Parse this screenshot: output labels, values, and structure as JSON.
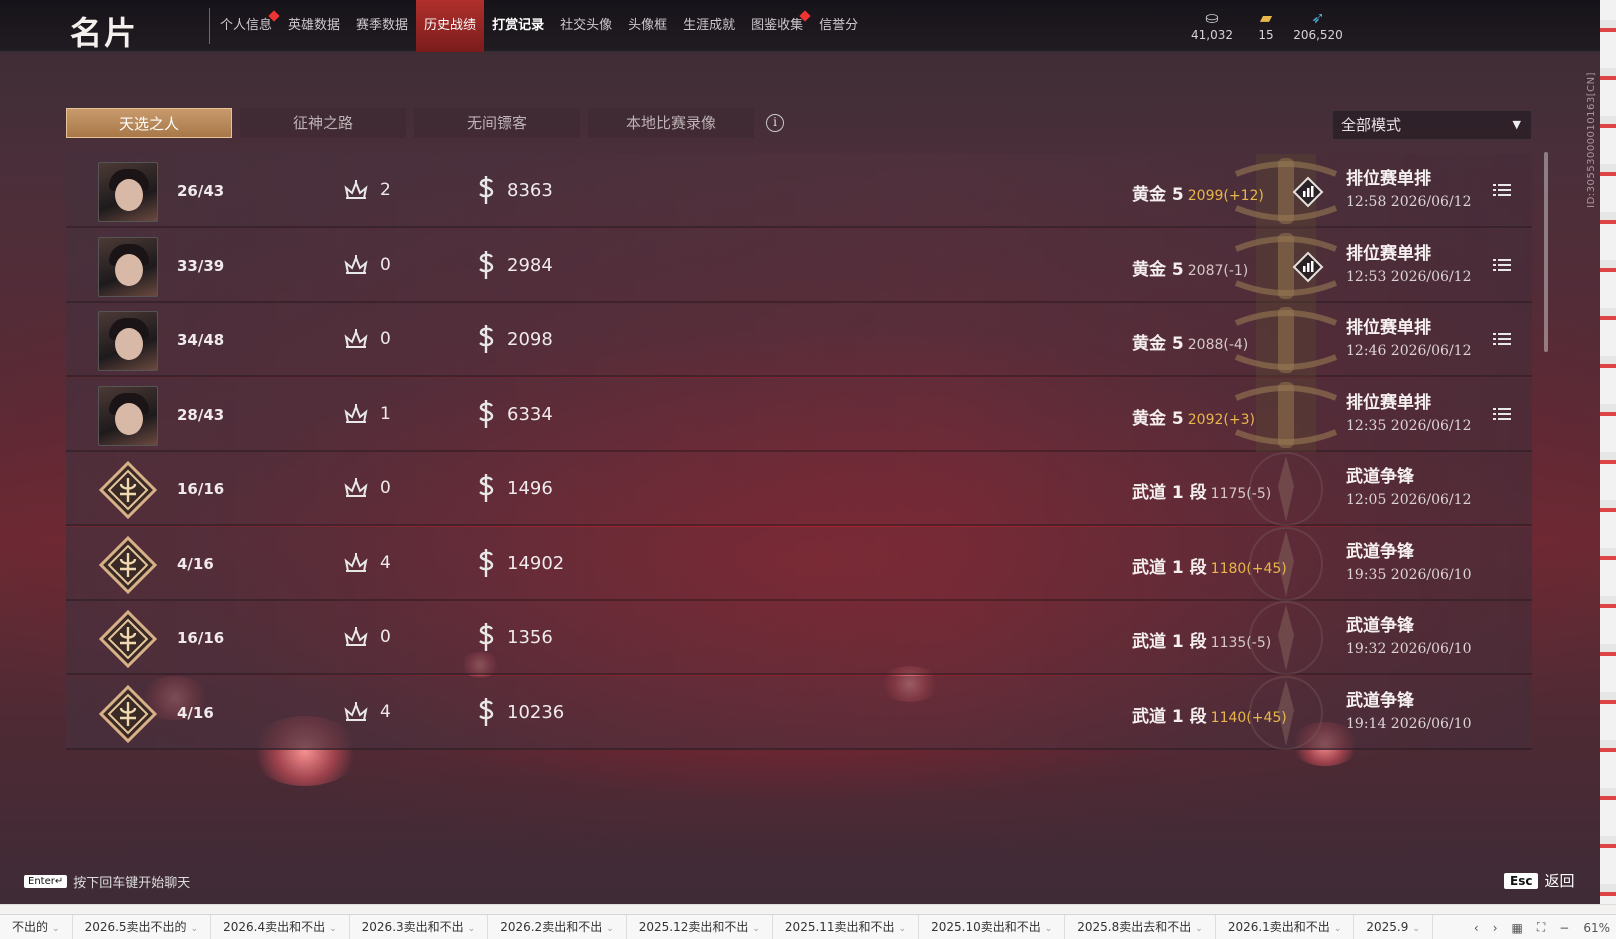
{
  "header": {
    "title": "名片",
    "nav": [
      {
        "label": "个人信息",
        "badge": true,
        "active": false,
        "bold": false
      },
      {
        "label": "英雄数据",
        "badge": false,
        "active": false,
        "bold": false
      },
      {
        "label": "赛季数据",
        "badge": false,
        "active": false,
        "bold": false
      },
      {
        "label": "历史战绩",
        "badge": false,
        "active": true,
        "bold": false
      },
      {
        "label": "打赏记录",
        "badge": false,
        "active": false,
        "bold": true
      },
      {
        "label": "社交头像",
        "badge": false,
        "active": false,
        "bold": false
      },
      {
        "label": "头像框",
        "badge": false,
        "active": false,
        "bold": false
      },
      {
        "label": "生涯成就",
        "badge": false,
        "active": false,
        "bold": false
      },
      {
        "label": "图鉴收集",
        "badge": true,
        "active": false,
        "bold": false
      },
      {
        "label": "信誉分",
        "badge": false,
        "active": false,
        "bold": false
      }
    ],
    "currencies": [
      {
        "icon": "coin-silver-icon",
        "value": "41,032"
      },
      {
        "icon": "ticket-icon",
        "value": "15"
      },
      {
        "icon": "feather-icon",
        "value": "206,520"
      }
    ]
  },
  "tabs": [
    {
      "label": "天选之人",
      "active": true
    },
    {
      "label": "征神之路",
      "active": false
    },
    {
      "label": "无间镖客",
      "active": false
    },
    {
      "label": "本地比赛录像",
      "active": false
    }
  ],
  "mode_filter": {
    "value": "全部模式"
  },
  "matches": [
    {
      "avatar": "portrait",
      "kda": "26/43",
      "mvp": "2",
      "gold": "8363",
      "rank": "黄金 5",
      "score": "2099(+12)",
      "delta": "gain",
      "mode": "排位赛单排",
      "time": "12:58 2026/06/12",
      "history": true,
      "detail": true
    },
    {
      "avatar": "portrait",
      "kda": "33/39",
      "mvp": "0",
      "gold": "2984",
      "rank": "黄金 5",
      "score": "2087(-1)",
      "delta": "loss",
      "mode": "排位赛单排",
      "time": "12:53 2026/06/12",
      "history": true,
      "detail": true
    },
    {
      "avatar": "portrait",
      "kda": "34/48",
      "mvp": "0",
      "gold": "2098",
      "rank": "黄金 5",
      "score": "2088(-4)",
      "delta": "loss",
      "mode": "排位赛单排",
      "time": "12:46 2026/06/12",
      "history": false,
      "detail": true
    },
    {
      "avatar": "portrait",
      "kda": "28/43",
      "mvp": "1",
      "gold": "6334",
      "rank": "黄金 5",
      "score": "2092(+3)",
      "delta": "gain",
      "mode": "排位赛单排",
      "time": "12:35 2026/06/12",
      "history": false,
      "detail": true
    },
    {
      "avatar": "emblem",
      "kda": "16/16",
      "mvp": "0",
      "gold": "1496",
      "rank": "武道 1 段",
      "score": "1175(-5)",
      "delta": "loss",
      "mode": "武道争锋",
      "time": "12:05 2026/06/12",
      "history": false,
      "detail": false
    },
    {
      "avatar": "emblem",
      "kda": "4/16",
      "mvp": "4",
      "gold": "14902",
      "rank": "武道 1 段",
      "score": "1180(+45)",
      "delta": "gain",
      "mode": "武道争锋",
      "time": "19:35 2026/06/10",
      "history": false,
      "detail": false
    },
    {
      "avatar": "emblem",
      "kda": "16/16",
      "mvp": "0",
      "gold": "1356",
      "rank": "武道 1 段",
      "score": "1135(-5)",
      "delta": "loss",
      "mode": "武道争锋",
      "time": "19:32 2026/06/10",
      "history": false,
      "detail": false
    },
    {
      "avatar": "emblem",
      "kda": "4/16",
      "mvp": "4",
      "gold": "10236",
      "rank": "武道 1 段",
      "score": "1140(+45)",
      "delta": "gain",
      "mode": "武道争锋",
      "time": "19:14 2026/06/10",
      "history": false,
      "detail": false
    }
  ],
  "side_id": "ID:30553000010163[CN]",
  "footer": {
    "chat_key": "Enter↵",
    "chat_hint": "按下回车键开始聊天",
    "back_key": "Esc",
    "back_label": "返回"
  },
  "taskbar": {
    "sheets": [
      "不出的",
      "2026.5卖出不出的",
      "2026.4卖出和不出",
      "2026.3卖出和不出",
      "2026.2卖出和不出",
      "2025.12卖出和不出",
      "2025.11卖出和不出",
      "2025.10卖出和不出",
      "2025.8卖出去和不出",
      "2026.1卖出和不出",
      "2025.9"
    ],
    "zoom": "61%"
  },
  "colors": {
    "accent_active": "#b0302c",
    "tab_active": "#c89a6c",
    "score_gain": "#e8b64a"
  }
}
